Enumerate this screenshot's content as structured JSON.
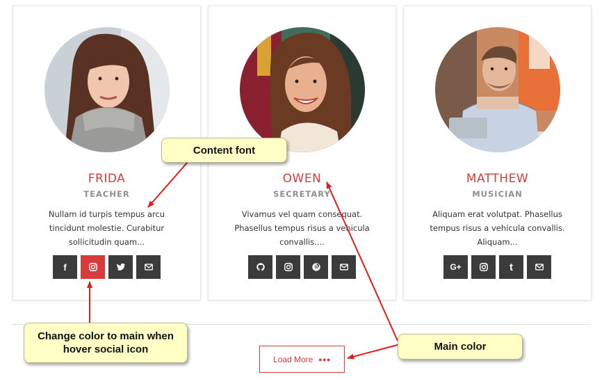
{
  "colors": {
    "main": "#d63c3c",
    "social_bg": "#3b3b3b",
    "callout_bg": "#ffffc6",
    "arrow": "#e11a1a"
  },
  "cards": [
    {
      "name": "FRIDA",
      "role": "TEACHER",
      "description": "Nullam id turpis tempus arcu tincidunt molestie. Curabitur sollicitudin quam...",
      "socials": [
        {
          "icon": "facebook-icon",
          "glyph": "f",
          "active": false
        },
        {
          "icon": "instagram-icon",
          "glyph": "",
          "active": true
        },
        {
          "icon": "twitter-icon",
          "glyph": "",
          "active": false
        },
        {
          "icon": "mail-icon",
          "glyph": "",
          "active": false
        }
      ]
    },
    {
      "name": "OWEN",
      "role": "SECRETARY",
      "description": "Vivamus vel quam consequat. Phasellus tempus risus a vehicula convallis....",
      "socials": [
        {
          "icon": "github-icon",
          "glyph": "",
          "active": false
        },
        {
          "icon": "instagram-icon",
          "glyph": "",
          "active": false
        },
        {
          "icon": "pinterest-icon",
          "glyph": "",
          "active": false
        },
        {
          "icon": "mail-icon",
          "glyph": "",
          "active": false
        }
      ]
    },
    {
      "name": "MATTHEW",
      "role": "MUSICIAN",
      "description": "Aliquam erat volutpat. Phasellus tempus risus a vehicula convallis. Aliquam...",
      "socials": [
        {
          "icon": "google-plus-icon",
          "glyph": "G+",
          "active": false
        },
        {
          "icon": "instagram-icon",
          "glyph": "",
          "active": false
        },
        {
          "icon": "tumblr-icon",
          "glyph": "t",
          "active": false
        },
        {
          "icon": "mail-icon",
          "glyph": "",
          "active": false
        }
      ]
    }
  ],
  "load_more": {
    "label": "Load More",
    "dots": "•••"
  },
  "callouts": {
    "content_font": "Content font",
    "hover_social": "Change color to main when hover social icon",
    "main_color": "Main color"
  }
}
